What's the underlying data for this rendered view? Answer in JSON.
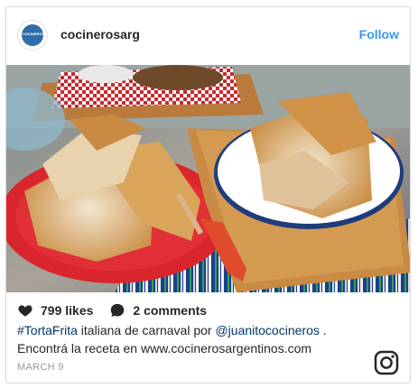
{
  "header": {
    "username": "cocinerosarg",
    "follow_label": "Follow",
    "avatar_text": "COCINEROS"
  },
  "stats": {
    "likes": "799 likes",
    "comments": "2 comments"
  },
  "caption": {
    "hashtag": "#TortaFrita",
    "text1": " italiana de carnaval por ",
    "mention": "@juanitococineros",
    "text2": " .",
    "line2": "Encontrá la receta en www.cocinerosargentinos.com"
  },
  "date": "MARCH 9",
  "colors": {
    "accent": "#3897f0",
    "link": "#003569",
    "text": "#262626",
    "muted": "#999999"
  },
  "icons": {
    "likes": "heart-icon",
    "comments": "speech-bubble-icon",
    "brand": "instagram-icon"
  }
}
